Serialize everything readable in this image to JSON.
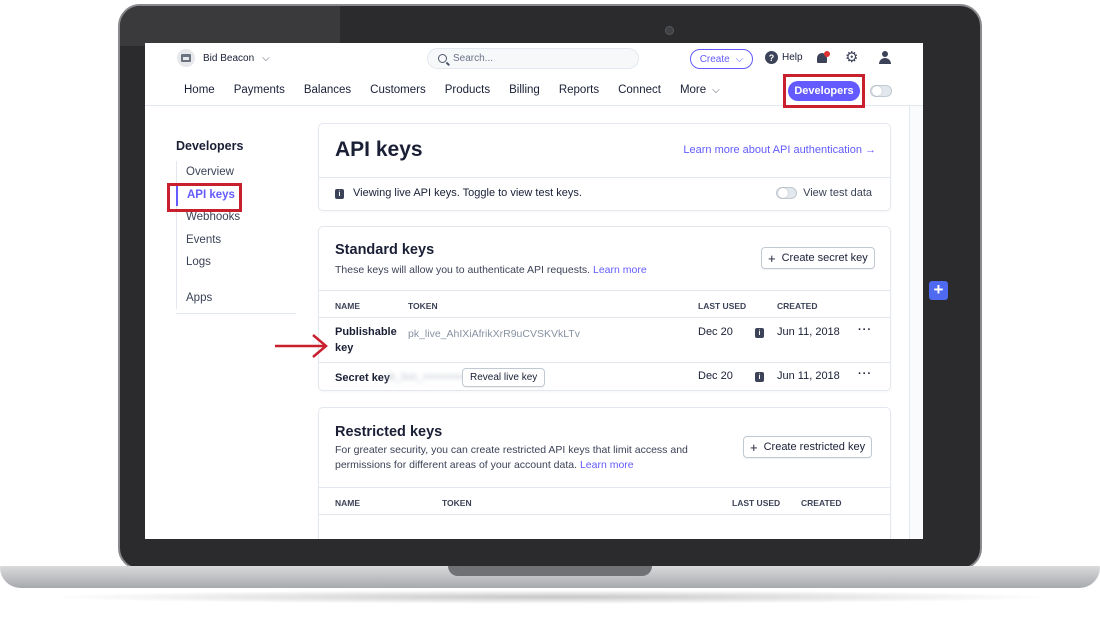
{
  "topbar": {
    "account_name": "Bid Beacon",
    "search_placeholder": "Search...",
    "create_label": "Create",
    "help_label": "Help"
  },
  "nav": {
    "items": [
      {
        "label": "Home"
      },
      {
        "label": "Payments"
      },
      {
        "label": "Balances"
      },
      {
        "label": "Customers"
      },
      {
        "label": "Products"
      },
      {
        "label": "Billing"
      },
      {
        "label": "Reports"
      },
      {
        "label": "Connect"
      }
    ],
    "more_label": "More",
    "developers_label": "Developers"
  },
  "sidebar": {
    "title": "Developers",
    "items": [
      {
        "label": "Overview"
      },
      {
        "label": "API keys"
      },
      {
        "label": "Webhooks"
      },
      {
        "label": "Events"
      },
      {
        "label": "Logs"
      },
      {
        "label": "Apps"
      }
    ]
  },
  "api_card": {
    "title": "API keys",
    "learn_link": "Learn more about API authentication →",
    "info_text": "Viewing live API keys. Toggle to view test keys.",
    "view_test_label": "View test data"
  },
  "standard_keys": {
    "title": "Standard keys",
    "description": "These keys will allow you to authenticate API requests.",
    "learn_more": "Learn more",
    "create_button": "Create secret key",
    "columns": {
      "name": "NAME",
      "token": "TOKEN",
      "last_used": "LAST USED",
      "created": "CREATED"
    },
    "rows": [
      {
        "name_line1": "Publishable",
        "name_line2": "key",
        "token": "pk_live_AhIXiAfrikXrR9uCVSKVkLTv",
        "last_used": "Dec 20",
        "created": "Jun 11, 2018"
      },
      {
        "name_line1": "Secret key",
        "name_line2": "",
        "token": "sk_live_•••••••••••••••••••••••••",
        "reveal_label": "Reveal live key",
        "last_used": "Dec 20",
        "created": "Jun 11, 2018"
      }
    ],
    "more_icon": "ellipsis-icon",
    "info_icon": "info-icon"
  },
  "restricted_keys": {
    "title": "Restricted keys",
    "description_line1": "For greater security, you can create restricted API keys that limit access and",
    "description_line2": "permissions for different areas of your account data.",
    "learn_more": "Learn more",
    "create_button": "Create restricted key",
    "columns": {
      "name": "NAME",
      "token": "TOKEN",
      "last_used": "LAST USED",
      "created": "CREATED"
    }
  },
  "colors": {
    "accent": "#635bff",
    "highlight_box": "#c8202d",
    "annotation_arrow": "#c8202d",
    "plus_badge": "#4f6af0"
  }
}
